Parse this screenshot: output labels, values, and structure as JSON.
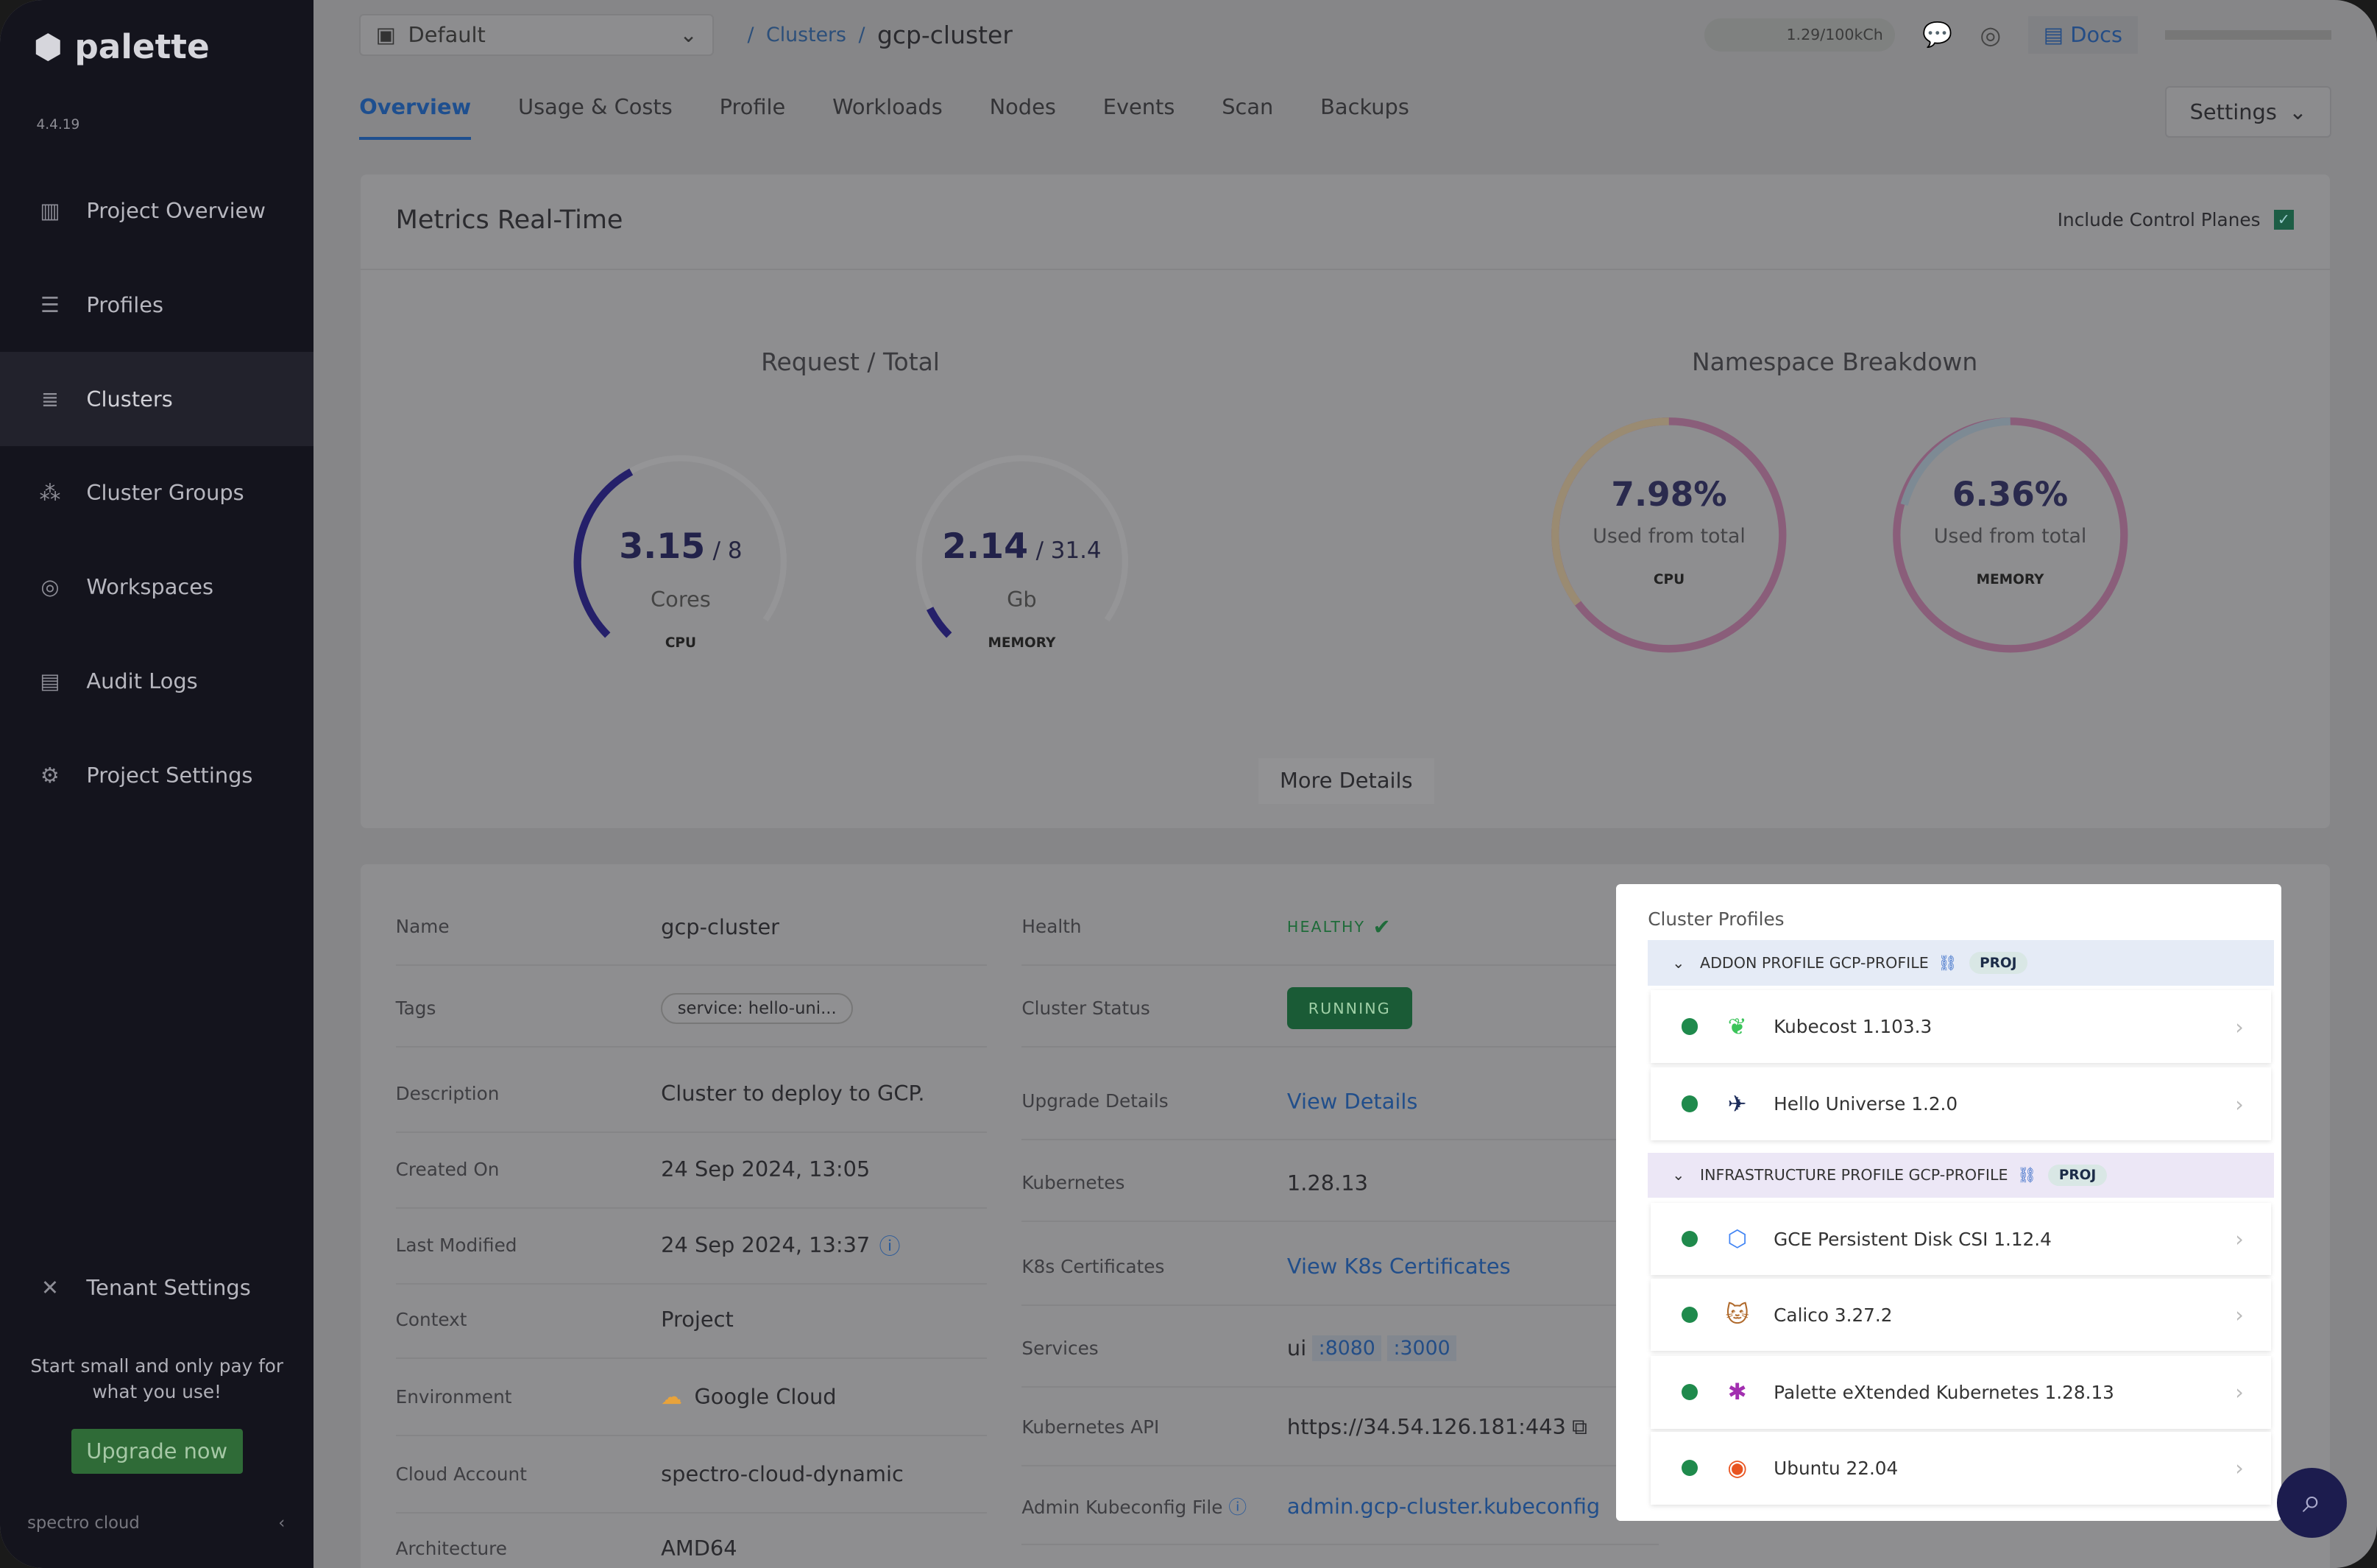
{
  "sidebar": {
    "brand": "palette",
    "version": "4.4.19",
    "items": [
      {
        "label": "Project Overview",
        "icon": "chart-icon"
      },
      {
        "label": "Profiles",
        "icon": "stack-icon"
      },
      {
        "label": "Clusters",
        "icon": "clusters-icon"
      },
      {
        "label": "Cluster Groups",
        "icon": "graph-icon"
      },
      {
        "label": "Workspaces",
        "icon": "target-icon"
      },
      {
        "label": "Audit Logs",
        "icon": "audit-icon"
      },
      {
        "label": "Project Settings",
        "icon": "gear-icon"
      }
    ],
    "tenant_settings": "Tenant Settings",
    "promo": "Start small and only pay for what you use!",
    "upgrade": "Upgrade now",
    "footer_brand": "spectro cloud"
  },
  "header": {
    "project": "Default",
    "breadcrumb_parent": "Clusters",
    "breadcrumb_current": "gcp-cluster",
    "credits": "1.29/100kCh",
    "docs": "Docs",
    "tabs": [
      "Overview",
      "Usage & Costs",
      "Profile",
      "Workloads",
      "Nodes",
      "Events",
      "Scan",
      "Backups"
    ],
    "active_tab": "Overview",
    "settings": "Settings"
  },
  "metrics": {
    "title": "Metrics Real-Time",
    "include_control_planes": "Include Control Planes",
    "include_checked": true,
    "request_title": "Request / Total",
    "cpu": {
      "value": "3.15",
      "total": "/ 8",
      "unit": "Cores",
      "label": "CPU",
      "fraction": 0.394
    },
    "memory": {
      "value": "2.14",
      "total": "/ 31.4",
      "unit": "Gb",
      "label": "MEMORY",
      "fraction": 0.068
    },
    "namespace_title": "Namespace Breakdown",
    "ns_cpu": {
      "percent": "7.98%",
      "sub": "Used from total",
      "label": "CPU"
    },
    "ns_memory": {
      "percent": "6.36%",
      "sub": "Used from total",
      "label": "MEMORY"
    },
    "more": "More Details"
  },
  "details": {
    "left": [
      {
        "k": "Name",
        "v": "gcp-cluster"
      },
      {
        "k": "Tags",
        "v": "service: hello-uni..."
      },
      {
        "k": "Description",
        "v": "Cluster to deploy to GCP."
      },
      {
        "k": "Created On",
        "v": "24 Sep 2024, 13:05"
      },
      {
        "k": "Last Modified",
        "v": "24 Sep 2024, 13:37"
      },
      {
        "k": "Context",
        "v": "Project"
      },
      {
        "k": "Environment",
        "v": "Google Cloud"
      },
      {
        "k": "Cloud Account",
        "v": "spectro-cloud-dynamic"
      },
      {
        "k": "Architecture",
        "v": "AMD64"
      }
    ],
    "right": [
      {
        "k": "Health",
        "v": "HEALTHY"
      },
      {
        "k": "Cluster Status",
        "v": "RUNNING"
      },
      {
        "k": "Upgrade Details",
        "v": "View Details"
      },
      {
        "k": "Kubernetes",
        "v": "1.28.13"
      },
      {
        "k": "K8s Certificates",
        "v": "View K8s Certificates"
      },
      {
        "k": "Services",
        "v": "ui",
        "ports": [
          ":8080",
          ":3000"
        ]
      },
      {
        "k": "Kubernetes API",
        "v": "https://34.54.126.181:443"
      },
      {
        "k": "Admin Kubeconfig File",
        "v": "admin.gcp-cluster.kubeconfig"
      }
    ]
  },
  "profiles": {
    "title": "Cluster Profiles",
    "addon": {
      "name": "ADDON PROFILE GCP-PROFILE",
      "badge": "PROJ",
      "items": [
        "Kubecost 1.103.3",
        "Hello Universe 1.2.0"
      ]
    },
    "infra": {
      "name": "INFRASTRUCTURE PROFILE GCP-PROFILE",
      "badge": "PROJ",
      "items": [
        "GCE Persistent Disk CSI 1.12.4",
        "Calico 3.27.2",
        "Palette eXtended Kubernetes 1.28.13",
        "Ubuntu 22.04"
      ]
    }
  },
  "colors": {
    "accent": "#1e4f8f",
    "healthy": "#1f8a4c",
    "running": "#1a5b36"
  }
}
